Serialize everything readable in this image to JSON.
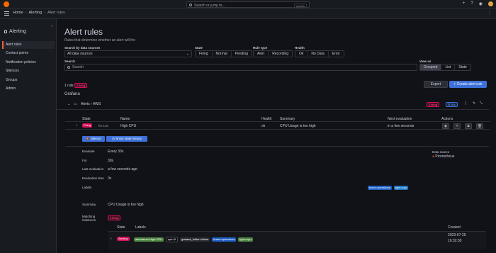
{
  "topbar": {
    "search_placeholder": "Search or jump to...",
    "search_shortcut": "cmd+k",
    "plus": "+",
    "help": "?",
    "rss": "◉"
  },
  "breadcrumb": {
    "home": "Home",
    "alerting": "Alerting",
    "current": "Alert rules"
  },
  "sidebar": {
    "title": "Alerting",
    "items": [
      {
        "label": "Alert rules",
        "active": true
      },
      {
        "label": "Contact points"
      },
      {
        "label": "Notification policies"
      },
      {
        "label": "Silences"
      },
      {
        "label": "Groups"
      },
      {
        "label": "Admin"
      }
    ]
  },
  "page": {
    "title": "Alert rules",
    "subtitle": "Rules that determine whether an alert will fire"
  },
  "filters": {
    "datasource_label": "Search by data sources",
    "datasource_value": "All data sources",
    "state_label": "State",
    "state_options": [
      "Firing",
      "Normal",
      "Pending"
    ],
    "ruletype_label": "Rule type",
    "ruletype_options": [
      "Alert",
      "Recording"
    ],
    "health_label": "Health",
    "health_options": [
      "Ok",
      "No Data",
      "Error"
    ],
    "search_label": "Search",
    "search_placeholder": "Search",
    "viewas_label": "View as",
    "viewas_options": [
      "Grouped",
      "List",
      "State"
    ]
  },
  "summary": {
    "count": "1 rule",
    "firing": "1 firing"
  },
  "actions": {
    "export": "Export",
    "create": "+ Create alert rule"
  },
  "group": {
    "source": "Grafana",
    "folder": "Alerts",
    "namespace": "AWS",
    "firing": "1 firing",
    "interval": "30s"
  },
  "table": {
    "headers": [
      "State",
      "Name",
      "Health",
      "Summary",
      "Next evaluation",
      "Actions"
    ],
    "row": {
      "state": "Firing",
      "duration": "for 13s",
      "name": "High CPU",
      "health": "ok",
      "summary": "CPU Usage is too high",
      "next": "in a few seconds"
    }
  },
  "detail": {
    "silence": "Silence",
    "history": "Show state history",
    "evaluate_label": "Evaluate",
    "evaluate_value": "Every 30s",
    "for_label": "For",
    "for_value": "30s",
    "last_eval_label": "Last evaluation",
    "last_eval_value": "a few seconds ago",
    "eval_time_label": "Evaluation time",
    "eval_time_value": "0s",
    "labels_label": "Labels",
    "labels": [
      "team=operations",
      "type=cpu"
    ],
    "datasource_label": "Data source",
    "datasource_value": "Prometheus",
    "summary_label": "Summary",
    "summary_value": "CPU Usage is too high",
    "matching_label": "Matching instances",
    "matching_firing": "1 firing"
  },
  "instances": {
    "headers": [
      "State",
      "Labels",
      "Created"
    ],
    "row": {
      "state": "Alerting",
      "labels": [
        "alertname=High CPU",
        "cpu=0",
        "grafana_folder=Alerts",
        "team=operations",
        "type=cpu"
      ],
      "created_date": "2023-07-25",
      "created_time": "16:32:30"
    }
  },
  "colors": {
    "firing": "#d10e5c",
    "primary": "#3d71d9",
    "accent": "#f55f3e"
  }
}
